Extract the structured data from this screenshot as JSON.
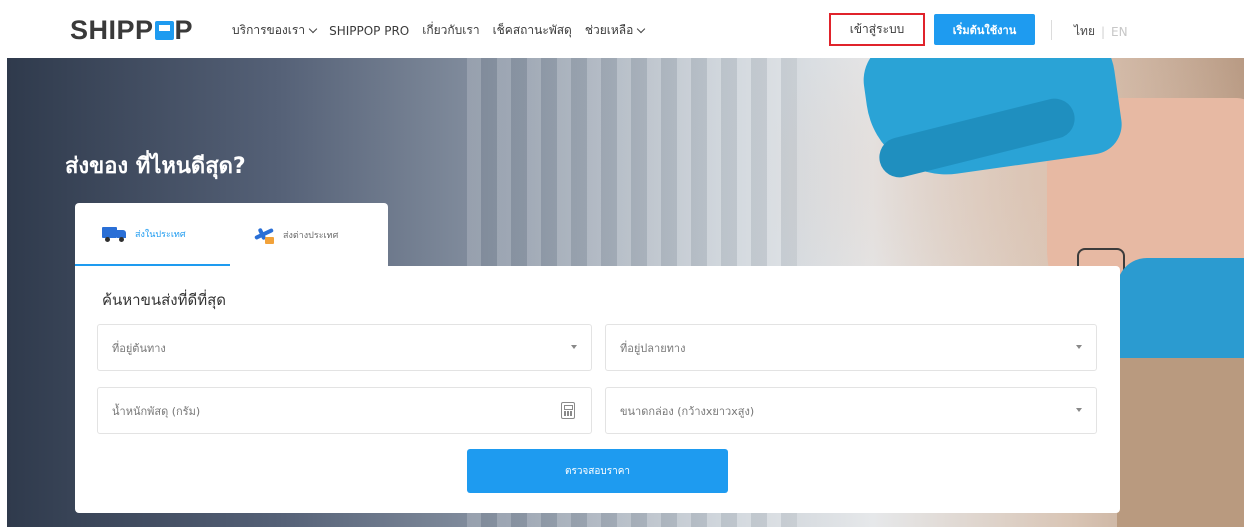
{
  "header": {
    "logo_text_left": "SHIPP",
    "logo_text_right": "P",
    "nav": [
      {
        "label": "บริการของเรา",
        "has_dropdown": true
      },
      {
        "label": "SHIPPOP PRO",
        "has_dropdown": false
      },
      {
        "label": "เกี่ยวกับเรา",
        "has_dropdown": false
      },
      {
        "label": "เช็คสถานะพัสดุ",
        "has_dropdown": false
      },
      {
        "label": "ช่วยเหลือ",
        "has_dropdown": true
      }
    ],
    "login_label": "เข้าสู่ระบบ",
    "start_label": "เริ่มต้นใช้งาน",
    "lang_th": "ไทย",
    "lang_sep": "|",
    "lang_en": "EN",
    "colors": {
      "accent": "#1e9bf0",
      "highlight": "#e0232b"
    }
  },
  "hero": {
    "title": "ส่งของ ที่ไหนดีสุด?"
  },
  "tabs": [
    {
      "label": "ส่งในประเทศ",
      "icon": "truck-icon",
      "active": true
    },
    {
      "label": "ส่งต่างประเทศ",
      "icon": "plane-icon",
      "active": false
    }
  ],
  "search": {
    "title": "ค้นหาขนส่งที่ดีที่สุด",
    "origin_placeholder": "ที่อยู่ต้นทาง",
    "destination_placeholder": "ที่อยู่ปลายทาง",
    "weight_placeholder": "น้ำหนักพัสดุ (กรัม)",
    "size_placeholder": "ขนาดกล่อง (กว้างxยาวxสูง)",
    "submit_label": "ตรวจสอบราคา"
  }
}
